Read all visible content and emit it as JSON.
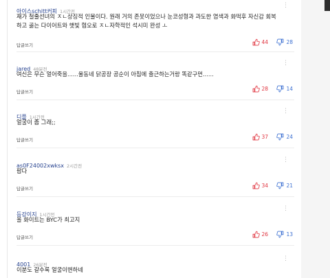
{
  "comments": [
    {
      "author": "아이스schitt커피",
      "time": "1시간전",
      "text": "재가 철줄선녀의 ㅈㄴ상징적 인물이다. 원래 거의 존못이었으나 눈코성형과 과도한 염색과 화떡후 자신감 회복하고 곪는 다이어트와 햇빛 혐오로 ㅈㄴ자학적인 석시미 완성 ㅗ",
      "reply_label": "답글쓰기",
      "likes": "44",
      "dislikes": "28"
    },
    {
      "author": "jared",
      "time": "48분전",
      "text": "여신은 무슨 얼어죽을......울동네 닭공장 공순이 아침에 출근하는거랑 똑같구먼......",
      "reply_label": "답글쓰기",
      "likes": "28",
      "dislikes": "14"
    },
    {
      "author": "디플",
      "time": "1시간전",
      "text": "얼굴이 좀 그래;;",
      "reply_label": "답글쓰기",
      "likes": "37",
      "dislikes": "24"
    },
    {
      "author": "as0F24002xwksx",
      "time": "2시간전",
      "text": "팝다",
      "reply_label": "답글쓰기",
      "likes": "34",
      "dislikes": "21"
    },
    {
      "author": "등강이지",
      "time": "1시간전",
      "text": "올 화이트는 BYC가 최고지",
      "reply_label": "답글쓰기",
      "likes": "26",
      "dislikes": "13"
    },
    {
      "author": "4001",
      "time": "26분전",
      "text": "이분도 갈수록 얼굴이변하네",
      "reply_label": "",
      "likes": "",
      "dislikes": ""
    }
  ],
  "colors": {
    "author": "#24408e",
    "likes": "#e0343f",
    "dislikes": "#3b6fd1"
  },
  "icons": {
    "like": "thumbs-up-icon",
    "dislike": "thumbs-down-icon",
    "more": "more-vertical-icon"
  }
}
